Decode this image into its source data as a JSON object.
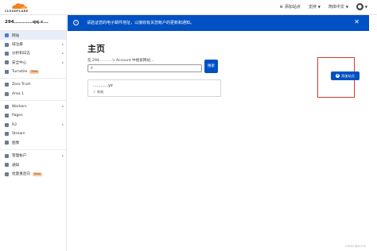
{
  "header": {
    "logo_text": "CLOUDFLARE",
    "add_site": "添加站点",
    "support": "支持",
    "language": "简体中文",
    "user_icon": "user-icon"
  },
  "sidebar": {
    "account": "294...........qq.c...",
    "items": [
      {
        "label": "网站",
        "active": true,
        "chevron": false
      },
      {
        "label": "域注册",
        "chevron": true
      },
      {
        "label": "分析和日志",
        "chevron": true
      },
      {
        "label": "安全中心",
        "chevron": true
      },
      {
        "label": "Turnstile",
        "badge": "Beta"
      },
      {
        "label": "Zero Trust"
      },
      {
        "label": "Area 1"
      },
      {
        "label": "Workers",
        "chevron": true
      },
      {
        "label": "Pages"
      },
      {
        "label": "R2",
        "chevron": true
      },
      {
        "label": "Stream"
      },
      {
        "label": "图像"
      },
      {
        "label": "管理帐户",
        "chevron": true
      },
      {
        "label": "通知"
      },
      {
        "label": "批量重定向",
        "badge": "Beta"
      }
    ]
  },
  "banner": {
    "text": "请验证您的电子邮件地址，以接收有关您帐户的更新和通知。",
    "close_icon": "close-icon"
  },
  "main": {
    "title": "主页",
    "search_hint": "在 294...........'s Account 中搜索网站...",
    "search_placeholder": "",
    "search_button": "搜索",
    "site": {
      "name": "............yz",
      "status": "✓ 有效"
    },
    "add_site_button": "添加站点"
  },
  "watermark": "CSDN @ss135"
}
